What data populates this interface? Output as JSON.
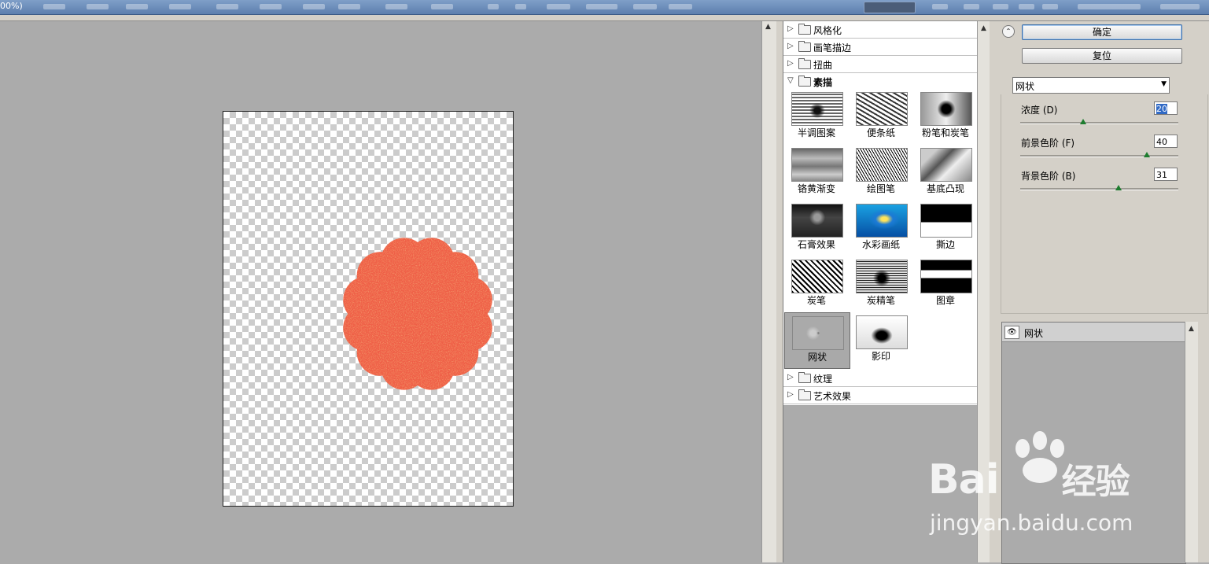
{
  "window": {
    "zoom_label": "00%)"
  },
  "filter_tree": {
    "categories": [
      {
        "label": "风格化",
        "open": false
      },
      {
        "label": "画笔描边",
        "open": false
      },
      {
        "label": "扭曲",
        "open": false
      },
      {
        "label": "素描",
        "open": true
      },
      {
        "label": "纹理",
        "open": false
      },
      {
        "label": "艺术效果",
        "open": false
      }
    ],
    "sketch_filters": [
      {
        "label": "半调图案",
        "icon": "halftone-thumb"
      },
      {
        "label": "便条纸",
        "icon": "note-paper-thumb"
      },
      {
        "label": "粉笔和炭笔",
        "icon": "chalk-charcoal-thumb"
      },
      {
        "label": "铬黄渐变",
        "icon": "chrome-thumb"
      },
      {
        "label": "绘图笔",
        "icon": "graphic-pen-thumb"
      },
      {
        "label": "基底凸现",
        "icon": "bas-relief-thumb"
      },
      {
        "label": "石膏效果",
        "icon": "plaster-thumb"
      },
      {
        "label": "水彩画纸",
        "icon": "water-paper-thumb"
      },
      {
        "label": "撕边",
        "icon": "torn-edges-thumb"
      },
      {
        "label": "炭笔",
        "icon": "charcoal-thumb"
      },
      {
        "label": "炭精笔",
        "icon": "conte-crayon-thumb"
      },
      {
        "label": "图章",
        "icon": "stamp-thumb"
      },
      {
        "label": "网状",
        "icon": "reticulation-thumb",
        "selected": true
      },
      {
        "label": "影印",
        "icon": "photocopy-thumb"
      }
    ]
  },
  "settings": {
    "ok_label": "确定",
    "reset_label": "复位",
    "selected_filter": "网状",
    "params": [
      {
        "label": "浓度 (D)",
        "value": "20",
        "slider": 0.4
      },
      {
        "label": "前景色阶 (F)",
        "value": "40",
        "slider": 0.8
      },
      {
        "label": "背景色阶 (B)",
        "value": "31",
        "slider": 0.62
      }
    ]
  },
  "layers": {
    "active_layer": "网状"
  },
  "colors": {
    "flower": "#ef5f47",
    "selection": "#316ac5"
  },
  "watermark": {
    "brand": "Bai",
    "brand_suffix": "经验",
    "url": "jingyan.baidu.com"
  }
}
